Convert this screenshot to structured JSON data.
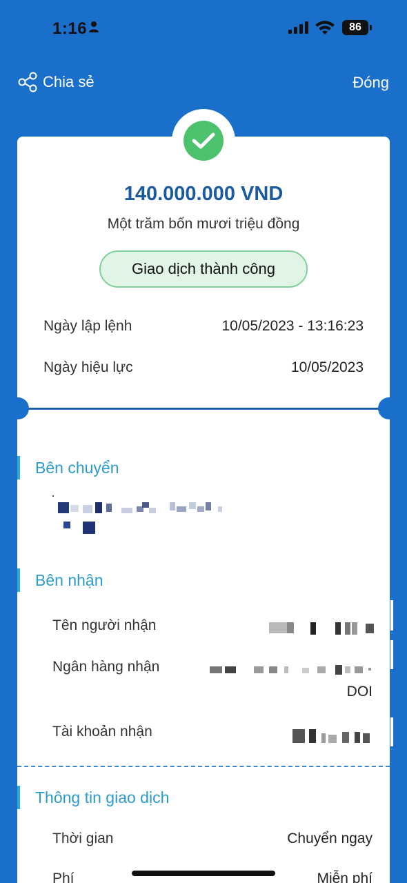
{
  "status_bar": {
    "time": "1:16",
    "battery": "86"
  },
  "header": {
    "share_label": "Chia sẻ",
    "close_label": "Đóng"
  },
  "receipt": {
    "amount": "140.000.000 VND",
    "amount_words": "Một trăm bốn mươi triệu đồng",
    "status": "Giao dịch thành công",
    "order_date_label": "Ngày lập lệnh",
    "order_date_value": "10/05/2023 - 13:16:23",
    "effective_date_label": "Ngày hiệu lực",
    "effective_date_value": "10/05/2023"
  },
  "sender_section": {
    "title": "Bên chuyển"
  },
  "receiver_section": {
    "title": "Bên nhận",
    "recipient_name_label": "Tên người nhận",
    "bank_label": "Ngân hàng nhận",
    "bank_value_suffix": "DOI",
    "account_label": "Tài khoản nhận"
  },
  "transaction_section": {
    "title": "Thông tin giao dịch",
    "time_label": "Thời gian",
    "time_value": "Chuyển ngay",
    "fee_label": "Phí",
    "fee_value": "Miễn phí"
  },
  "colors": {
    "background": "#1a6fca",
    "amount": "#1a5a9e",
    "success": "#4cc26d",
    "section_title": "#2b9bc7"
  },
  "icons": {
    "share": "share-icon",
    "success": "check-icon"
  }
}
